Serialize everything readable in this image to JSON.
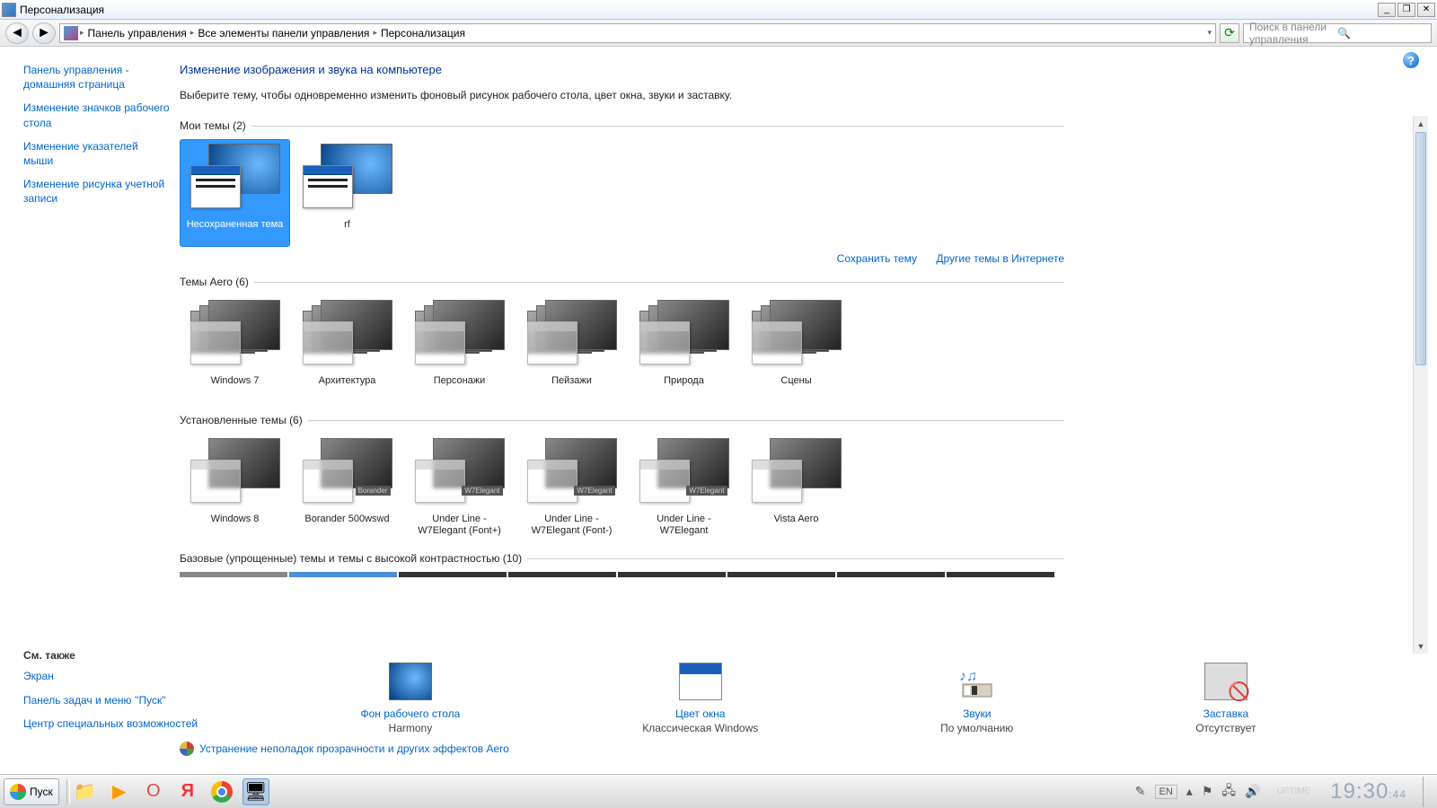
{
  "window": {
    "title": "Персонализация",
    "minimize": "_",
    "restore": "❐",
    "close": "✕"
  },
  "nav": {
    "crumbs": [
      "Панель управления",
      "Все элементы панели управления",
      "Персонализация"
    ],
    "search_placeholder": "Поиск в панели управления"
  },
  "sidebar": {
    "links": [
      "Панель управления - домашняя страница",
      "Изменение значков рабочего стола",
      "Изменение указателей мыши",
      "Изменение рисунка учетной записи"
    ]
  },
  "main": {
    "heading": "Изменение изображения и звука на компьютере",
    "sub": "Выберите тему, чтобы одновременно изменить фоновый рисунок рабочего стола, цвет окна, звуки и заставку.",
    "sect_my": "Мои темы (2)",
    "sect_aero": "Темы Aero (6)",
    "sect_installed": "Установленные темы (6)",
    "sect_basic": "Базовые (упрощенные) темы и темы с высокой контрастностью (10)",
    "save_theme": "Сохранить тему",
    "more_themes": "Другие темы в Интернете",
    "my_themes": [
      {
        "label": "Несохраненная тема",
        "selected": true
      },
      {
        "label": "rf",
        "selected": false
      }
    ],
    "aero_themes": [
      "Windows 7",
      "Архитектура",
      "Персонажи",
      "Пейзажи",
      "Природа",
      "Сцены"
    ],
    "installed_themes": [
      {
        "label": "Windows 8",
        "tag": ""
      },
      {
        "label": "Borander 500wswd",
        "tag": "Borander"
      },
      {
        "label": "Under Line - W7Elegant (Font+)",
        "tag": "W7Elegant"
      },
      {
        "label": "Under Line - W7Elegant (Font-)",
        "tag": "W7Elegant"
      },
      {
        "label": "Under Line - W7Elegant",
        "tag": "W7Elegant"
      },
      {
        "label": "Vista Aero",
        "tag": ""
      }
    ]
  },
  "bottom": {
    "bg": {
      "link": "Фон рабочего стола",
      "val": "Harmony"
    },
    "color": {
      "link": "Цвет окна",
      "val": "Классическая Windows"
    },
    "sound": {
      "link": "Звуки",
      "val": "По умолчанию"
    },
    "saver": {
      "link": "Заставка",
      "val": "Отсутствует"
    },
    "troubleshoot": "Устранение неполадок прозрачности и других эффектов Aero"
  },
  "see_also": {
    "head": "См. также",
    "links": [
      "Экран",
      "Панель задач и меню ''Пуск''",
      "Центр специальных возможностей"
    ]
  },
  "taskbar": {
    "start": "Пуск",
    "lang": "EN",
    "uptime_label": "UPTIME",
    "clock": "19:30",
    "clock_sec": "44"
  }
}
